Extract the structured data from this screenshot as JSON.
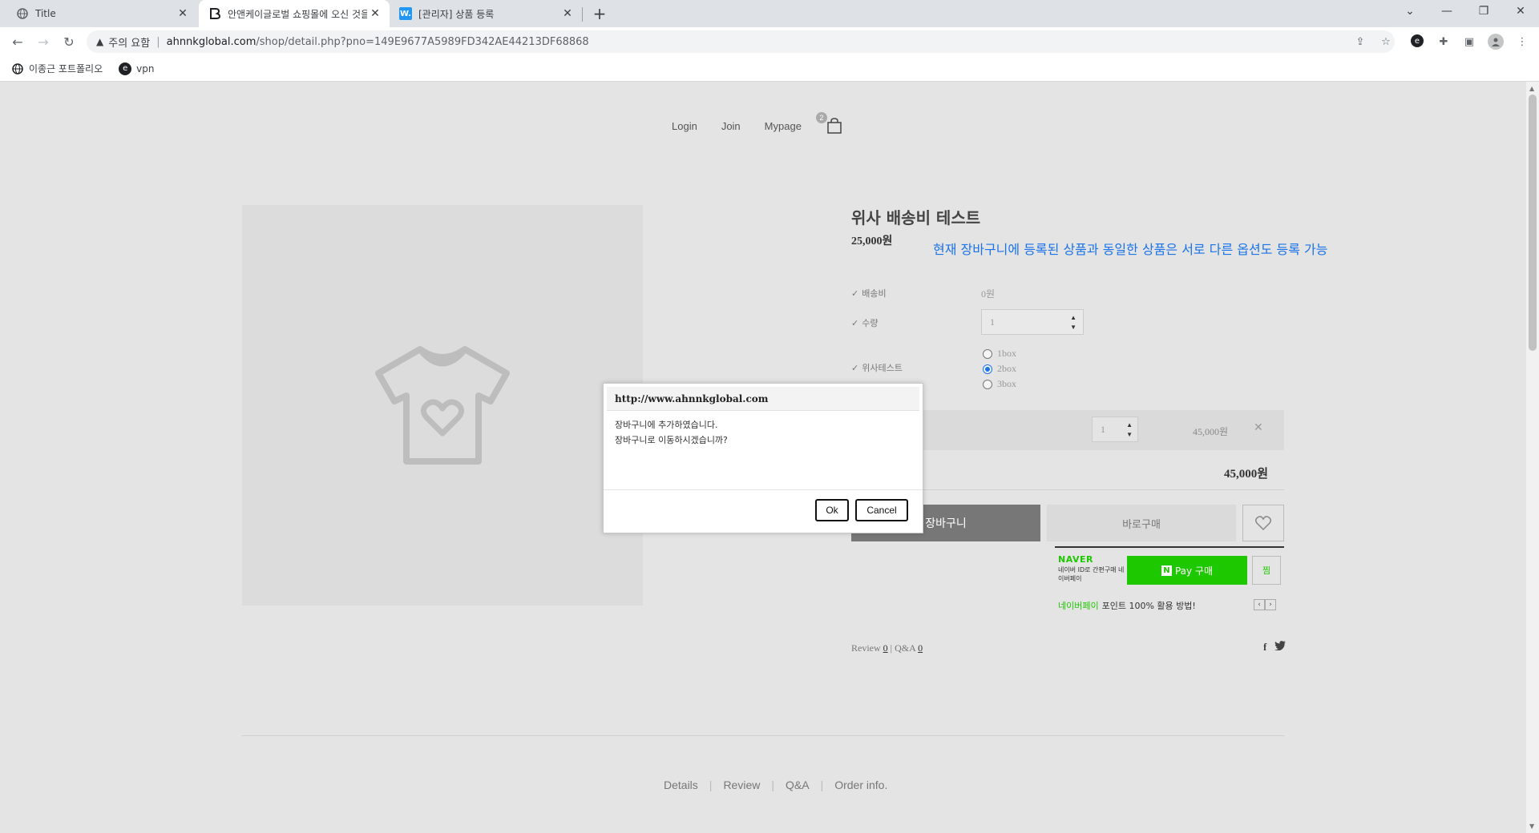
{
  "browser": {
    "tabs": [
      {
        "title": "Title",
        "icon": "globe-icon"
      },
      {
        "title": "안앤케이글로벌 쇼핑몰에 오신 것을",
        "icon": "b-logo-icon"
      },
      {
        "title": "[관리자] 상품 등록",
        "icon": "w-logo-icon"
      }
    ],
    "address": {
      "warning": "주의 요함",
      "host": "ahnnkglobal.com",
      "path": "/shop/detail.php?pno=149E9677A5989FD342AE44213DF68868"
    },
    "bookmarks": [
      {
        "label": "이종근 포트폴리오",
        "icon": "globe-icon"
      },
      {
        "label": "vpn",
        "icon": "e-logo-icon"
      }
    ]
  },
  "site": {
    "nav": {
      "login": "Login",
      "join": "Join",
      "mypage": "Mypage",
      "cart_count": "2"
    },
    "product": {
      "name": "위사 배송비 테스트",
      "price": "25,000원",
      "note": "현재 장바구니에 등록된 상품과 동일한 상품은 서로 다른 옵션도 등록 가능",
      "shipping_label": "배송비",
      "shipping_value": "0원",
      "qty_label": "수량",
      "qty_value": "1",
      "option_label": "위사테스트",
      "options": [
        {
          "label": "1box",
          "checked": false
        },
        {
          "label": "2box",
          "checked": true
        },
        {
          "label": "3box",
          "checked": false
        }
      ],
      "selected_qty": "1",
      "selected_price": "45,000원",
      "total": "45,000원",
      "cart_button": "장바구니",
      "buy_button": "바로구매"
    },
    "naver": {
      "logo": "NAVER",
      "desc": "네이버 ID로 간편구매 네이버페이",
      "pay_n": "N",
      "pay_label": "Pay 구매",
      "zzim": "찜",
      "point_brand": "네이버페이",
      "point_text": "포인트 100% 활용 방법!"
    },
    "review": {
      "review_label": "Review",
      "review_count": "0",
      "sep": "|",
      "qa_label": "Q&A",
      "qa_count": "0"
    },
    "bottom_tabs": [
      "Details",
      "Review",
      "Q&A",
      "Order info."
    ]
  },
  "dialog": {
    "title": "http://www.ahnnkglobal.com",
    "line1": "장바구니에 추가하였습니다.",
    "line2": "장바구니로 이동하시겠습니까?",
    "ok": "Ok",
    "cancel": "Cancel"
  }
}
